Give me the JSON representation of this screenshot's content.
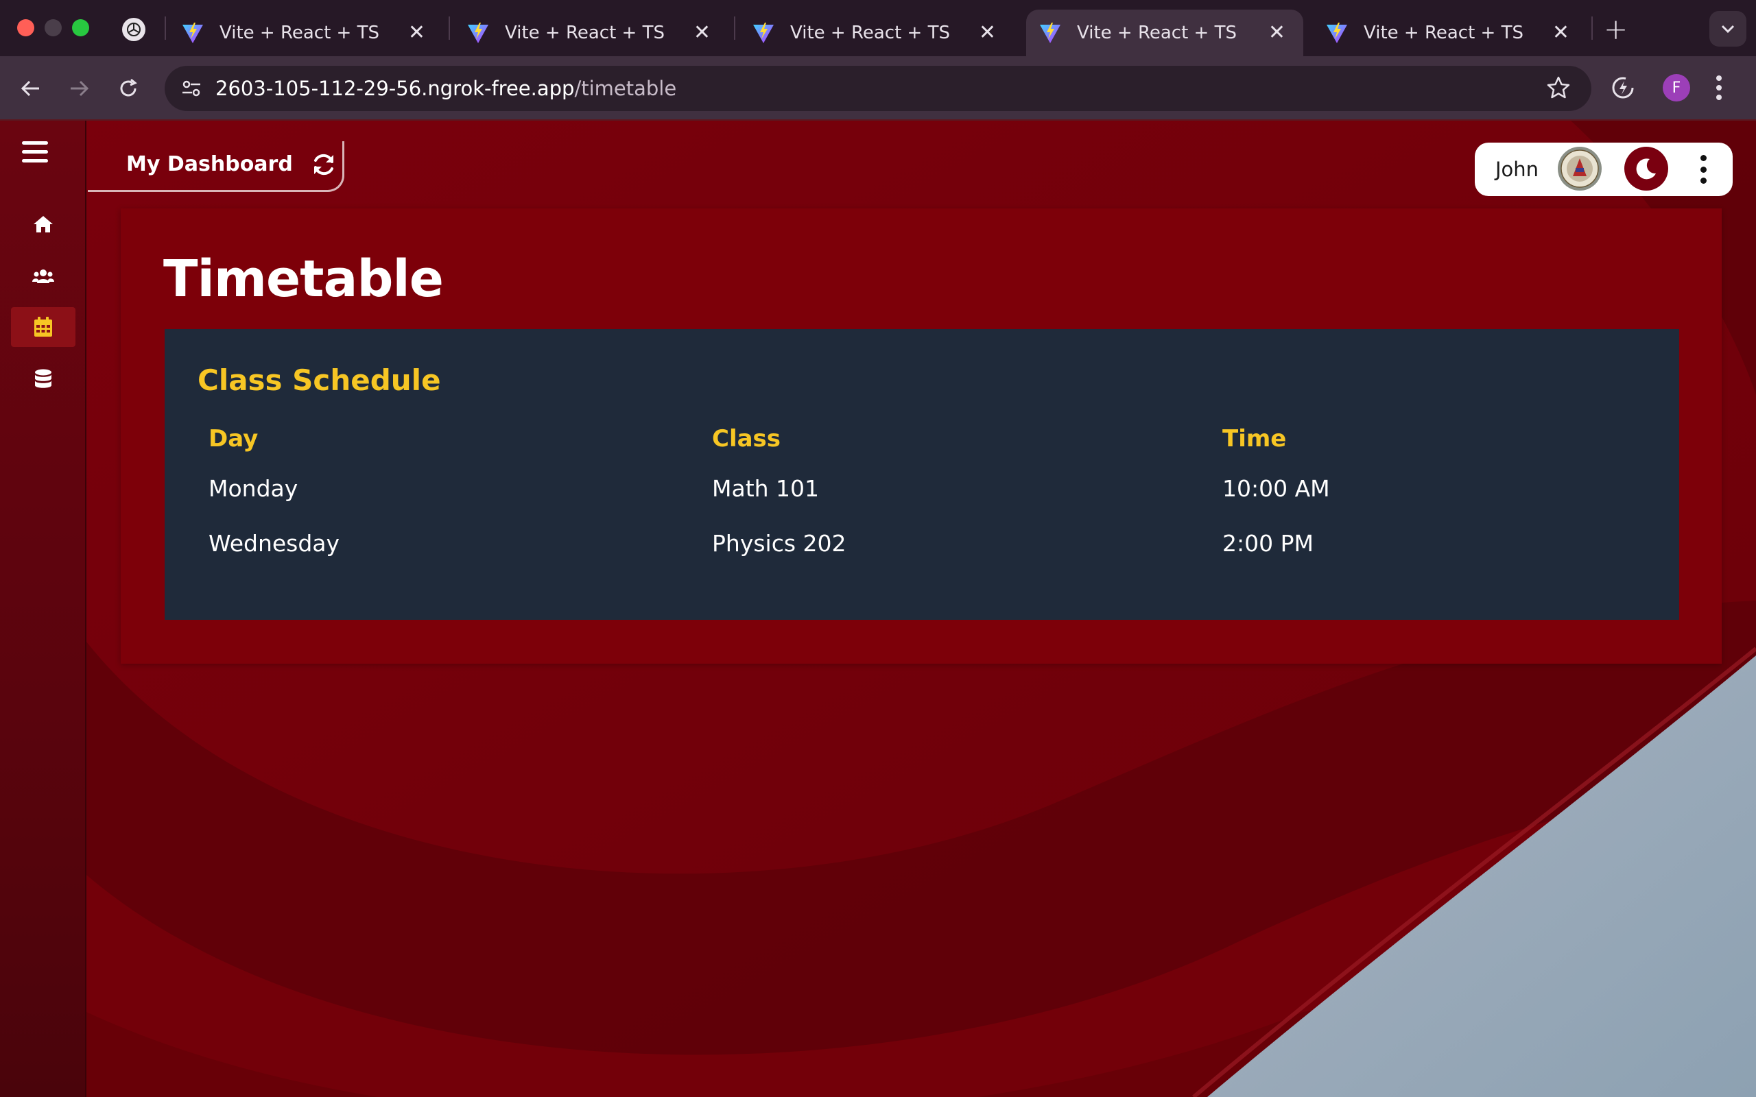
{
  "browser": {
    "tabs": [
      {
        "title": "Vite + React + TS",
        "active": false
      },
      {
        "title": "Vite + React + TS",
        "active": false
      },
      {
        "title": "Vite + React + TS",
        "active": false
      },
      {
        "title": "Vite + React + TS",
        "active": true
      },
      {
        "title": "Vite + React + TS",
        "active": false
      }
    ],
    "new_tab_symbol": "+",
    "close_symbol": "✕",
    "url_host": "2603-105-112-29-56.ngrok-free.app",
    "url_path": "/timetable",
    "profile_initial": "F"
  },
  "sidebar": {
    "items": [
      {
        "icon": "home-icon",
        "active": false
      },
      {
        "icon": "users-icon",
        "active": false
      },
      {
        "icon": "calendar-icon",
        "active": true
      },
      {
        "icon": "database-icon",
        "active": false
      }
    ]
  },
  "header": {
    "dashboard_label": "My Dashboard",
    "user_name": "John"
  },
  "page": {
    "title": "Timetable",
    "schedule": {
      "title": "Class Schedule",
      "columns": [
        "Day",
        "Class",
        "Time"
      ],
      "rows": [
        [
          "Monday",
          "Math 101",
          "10:00 AM"
        ],
        [
          "Wednesday",
          "Physics 202",
          "2:00 PM"
        ]
      ]
    }
  },
  "colors": {
    "accent": "#f7c624",
    "app_background": "#7d0009",
    "panel": "#1f2a3a",
    "sidebar_active": "#8c1017"
  }
}
